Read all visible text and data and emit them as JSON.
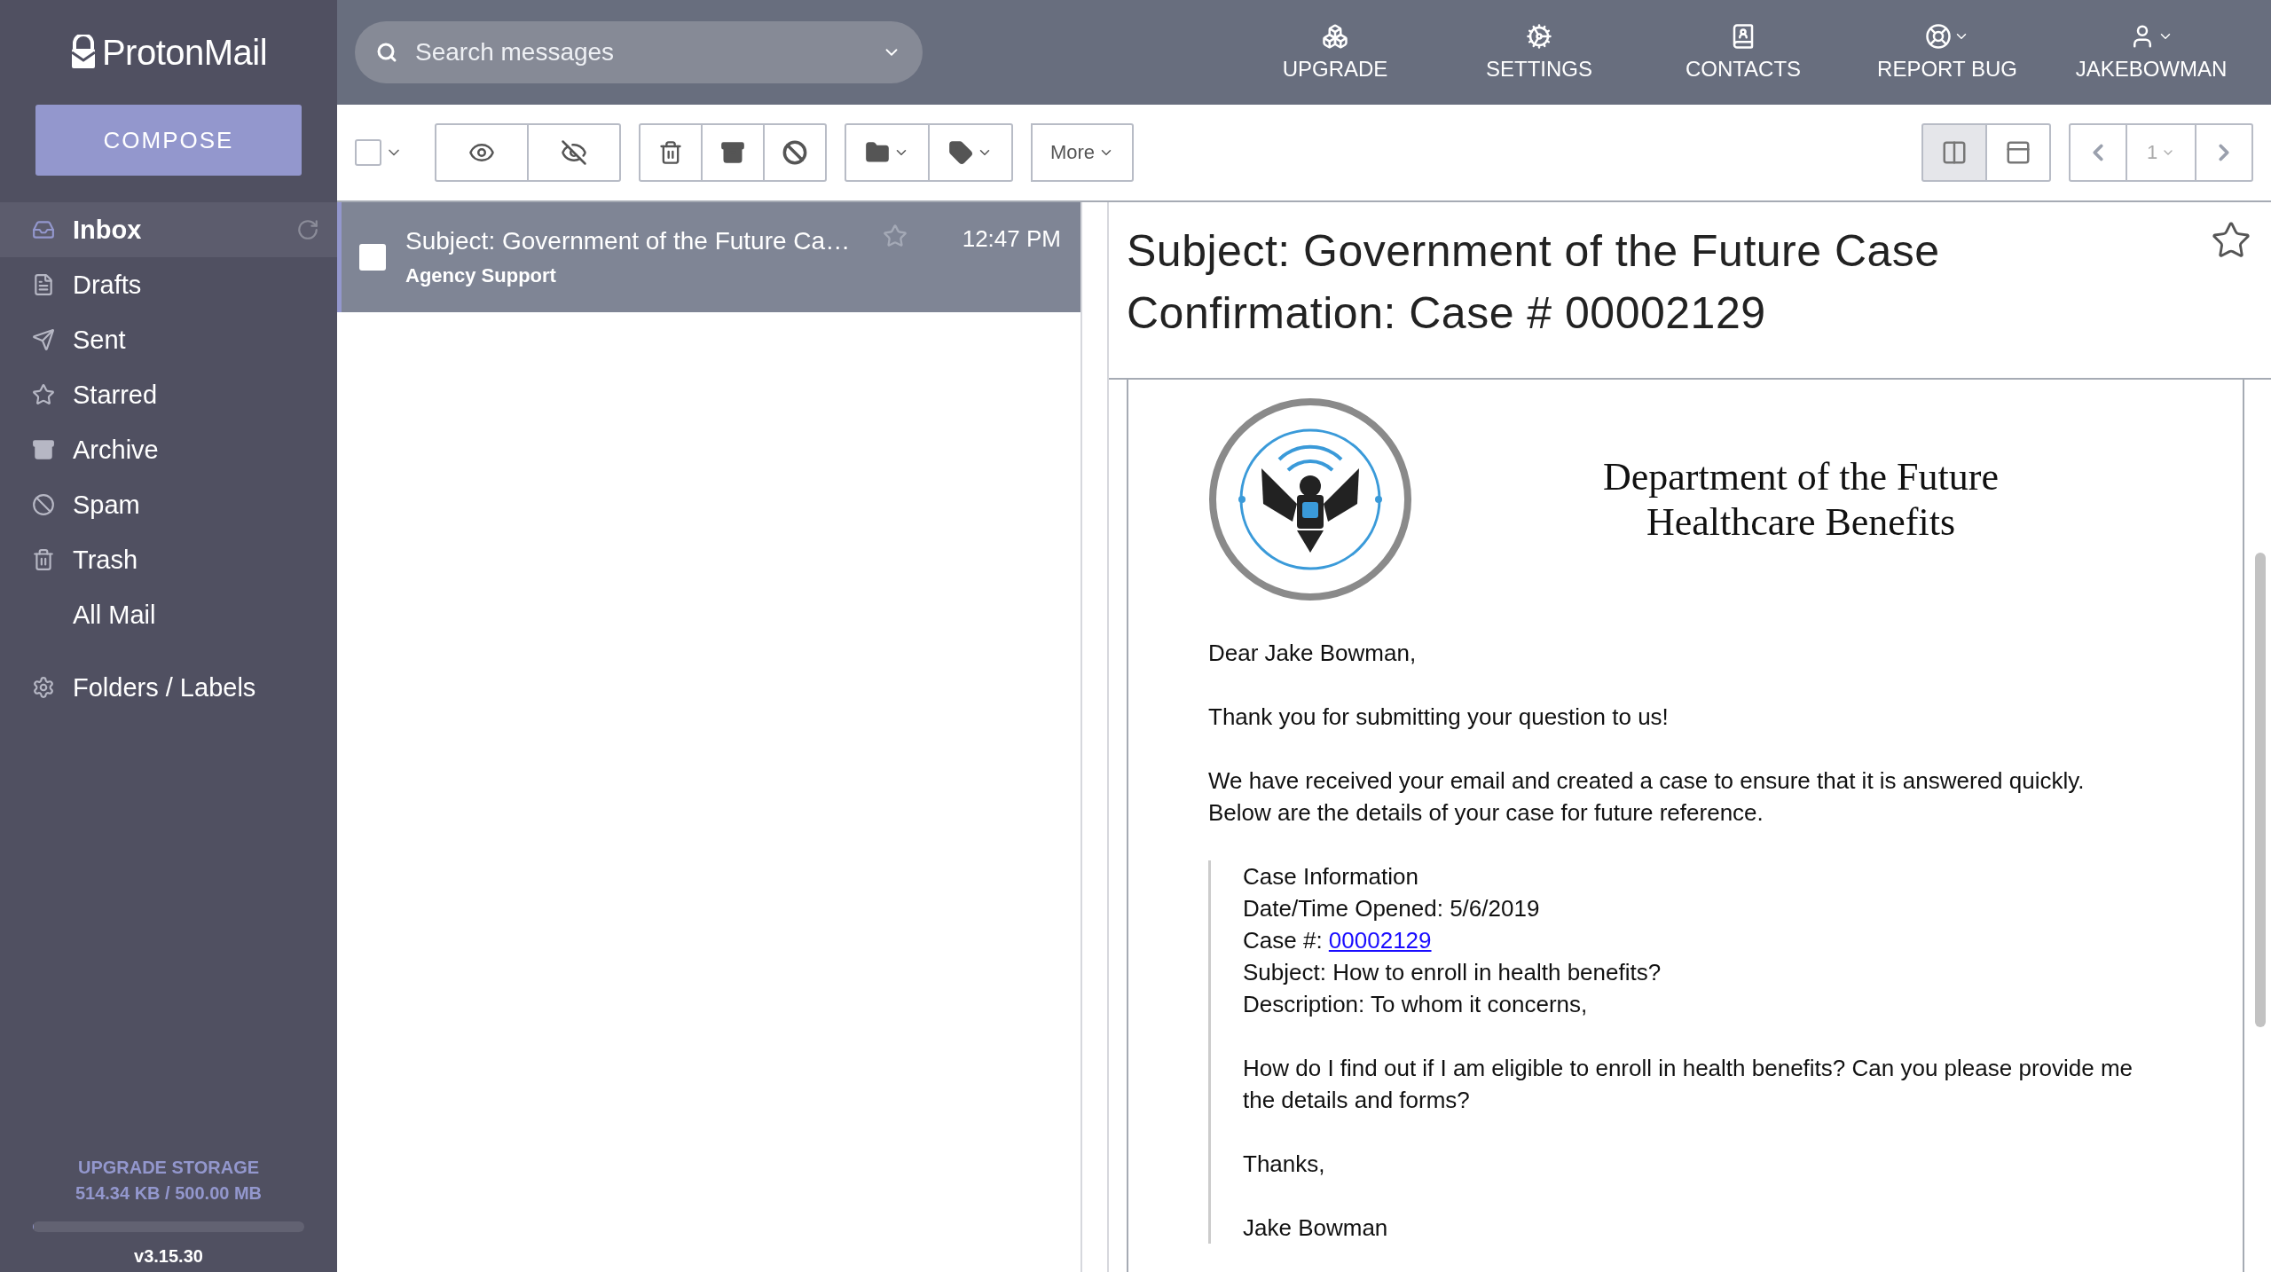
{
  "sidebar": {
    "logo": "ProtonMail",
    "compose": "COMPOSE",
    "items": [
      {
        "label": "Inbox",
        "selected": true,
        "refresh": true
      },
      {
        "label": "Drafts",
        "selected": false,
        "refresh": false
      },
      {
        "label": "Sent",
        "selected": false,
        "refresh": false
      },
      {
        "label": "Starred",
        "selected": false,
        "refresh": false
      },
      {
        "label": "Archive",
        "selected": false,
        "refresh": false
      },
      {
        "label": "Spam",
        "selected": false,
        "refresh": false
      },
      {
        "label": "Trash",
        "selected": false,
        "refresh": false
      },
      {
        "label": "All Mail",
        "selected": false,
        "refresh": false
      }
    ],
    "folders_labels": "Folders / Labels",
    "storage": {
      "title": "UPGRADE STORAGE",
      "usage": "514.34 KB / 500.00 MB",
      "level": 0.001
    },
    "version": "v3.15.30"
  },
  "search": {
    "placeholder": "Search messages"
  },
  "nav": [
    {
      "label": "UPGRADE",
      "dropdown": false
    },
    {
      "label": "SETTINGS",
      "dropdown": false
    },
    {
      "label": "CONTACTS",
      "dropdown": false
    },
    {
      "label": "REPORT BUG",
      "dropdown": true
    },
    {
      "label": "JAKEBOWMAN",
      "dropdown": true
    }
  ],
  "toolbar": {
    "select_all_checked": false,
    "more": "More",
    "page": "1",
    "layouts": [
      {
        "kind": "columns",
        "selected": true
      },
      {
        "kind": "rows",
        "selected": false
      }
    ]
  },
  "messages": [
    {
      "subject": "Subject: Government of the Future Ca…",
      "sender": "Agency Support",
      "time": "12:47 PM",
      "selected": true,
      "checked": false,
      "starred": false
    }
  ],
  "reader": {
    "subject": "Subject: Government of the Future Case Confirmation: Case # 00002129",
    "starred": false,
    "org_title": [
      "Department of the Future",
      "Healthcare Benefits"
    ],
    "greeting": "Dear Jake Bowman,",
    "paragraphs": [
      [
        "Thank you for submitting your question to us!"
      ],
      [
        "We have received your email and created a case to ensure that it is answered quickly.",
        "Below are the details of your case for future reference."
      ]
    ],
    "case": {
      "heading": "Case Information",
      "opened": "Date/Time Opened: 5/6/2019",
      "case_label": "Case #:",
      "case_link": "00002129",
      "subject": "Subject: How to enroll in health benefits?",
      "description": "Description: To whom it concerns,",
      "question": "How do I find out if I am eligible to enroll in health benefits? Can you please provide me the details and forms?",
      "thanks": "Thanks,",
      "signature": "Jake Bowman"
    }
  }
}
